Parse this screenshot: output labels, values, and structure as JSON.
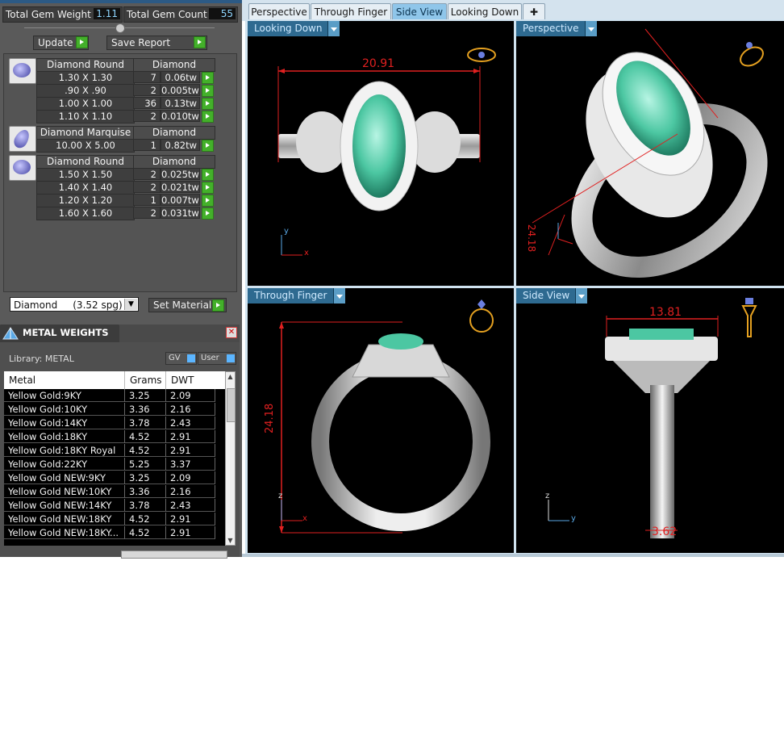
{
  "summary": {
    "weight_label": "Total Gem Weight",
    "weight_value": "1.11",
    "count_label": "Total Gem Count",
    "count_value": "55",
    "update_label": "Update",
    "save_label": "Save Report"
  },
  "gem_groups": [
    {
      "name": "Diamond Round",
      "material": "Diamond",
      "icon": "round-gem-icon",
      "rows": [
        {
          "size": "1.30 X 1.30",
          "count": "7",
          "weight": "0.06tw"
        },
        {
          "size": ".90 X .90",
          "count": "2",
          "weight": "0.005tw"
        },
        {
          "size": "1.00 X 1.00",
          "count": "36",
          "weight": "0.13tw"
        },
        {
          "size": "1.10 X 1.10",
          "count": "2",
          "weight": "0.010tw"
        }
      ]
    },
    {
      "name": "Diamond Marquise",
      "material": "Diamond",
      "icon": "marquise-gem-icon",
      "rows": [
        {
          "size": "10.00 X 5.00",
          "count": "1",
          "weight": "0.82tw"
        }
      ]
    },
    {
      "name": "Diamond Round",
      "material": "Diamond",
      "icon": "round-gem-icon",
      "rows": [
        {
          "size": "1.50 X 1.50",
          "count": "2",
          "weight": "0.025tw"
        },
        {
          "size": "1.40 X 1.40",
          "count": "2",
          "weight": "0.021tw"
        },
        {
          "size": "1.20 X 1.20",
          "count": "1",
          "weight": "0.007tw"
        },
        {
          "size": "1.60 X 1.60",
          "count": "2",
          "weight": "0.031tw"
        }
      ]
    }
  ],
  "material": {
    "selected": "Diamond     (3.52 spg)",
    "set_label": "Set Material"
  },
  "metal_weights": {
    "title": "METAL WEIGHTS",
    "library": "Library: METAL",
    "gv_label": "GV",
    "user_label": "User",
    "columns": [
      "Metal",
      "Grams",
      "DWT"
    ],
    "rows": [
      [
        "Yellow Gold:9KY",
        "3.25",
        "2.09"
      ],
      [
        "Yellow Gold:10KY",
        "3.36",
        "2.16"
      ],
      [
        "Yellow Gold:14KY",
        "3.78",
        "2.43"
      ],
      [
        "Yellow Gold:18KY",
        "4.52",
        "2.91"
      ],
      [
        "Yellow Gold:18KY Royal",
        "4.52",
        "2.91"
      ],
      [
        "Yellow Gold:22KY",
        "5.25",
        "3.37"
      ],
      [
        "Yellow Gold NEW:9KY",
        "3.25",
        "2.09"
      ],
      [
        "Yellow Gold NEW:10KY",
        "3.36",
        "2.16"
      ],
      [
        "Yellow Gold NEW:14KY",
        "3.78",
        "2.43"
      ],
      [
        "Yellow Gold NEW:18KY",
        "4.52",
        "2.91"
      ],
      [
        "Yellow Gold NEW:18KY...",
        "4.52",
        "2.91"
      ]
    ]
  },
  "tabs": [
    "Perspective",
    "Through Finger",
    "Side View",
    "Looking Down"
  ],
  "active_tab": "Side View",
  "viewports": {
    "top_left": {
      "label": "Looking Down",
      "dimension": "20.91"
    },
    "top_right": {
      "label": "Perspective",
      "dimension": "24.18"
    },
    "bottom_left": {
      "label": "Through Finger",
      "dimension": "24.18"
    },
    "bottom_right": {
      "label": "Side View",
      "dimension_top": "13.81",
      "dimension_bottom": "3.62"
    }
  },
  "colors": {
    "dimension_red": "#e02020",
    "gem_green": "#5fd3b0",
    "metal_silver": "#c8c8c8",
    "active_tab": "#8fc6ea",
    "go_green": "#43b02a"
  }
}
